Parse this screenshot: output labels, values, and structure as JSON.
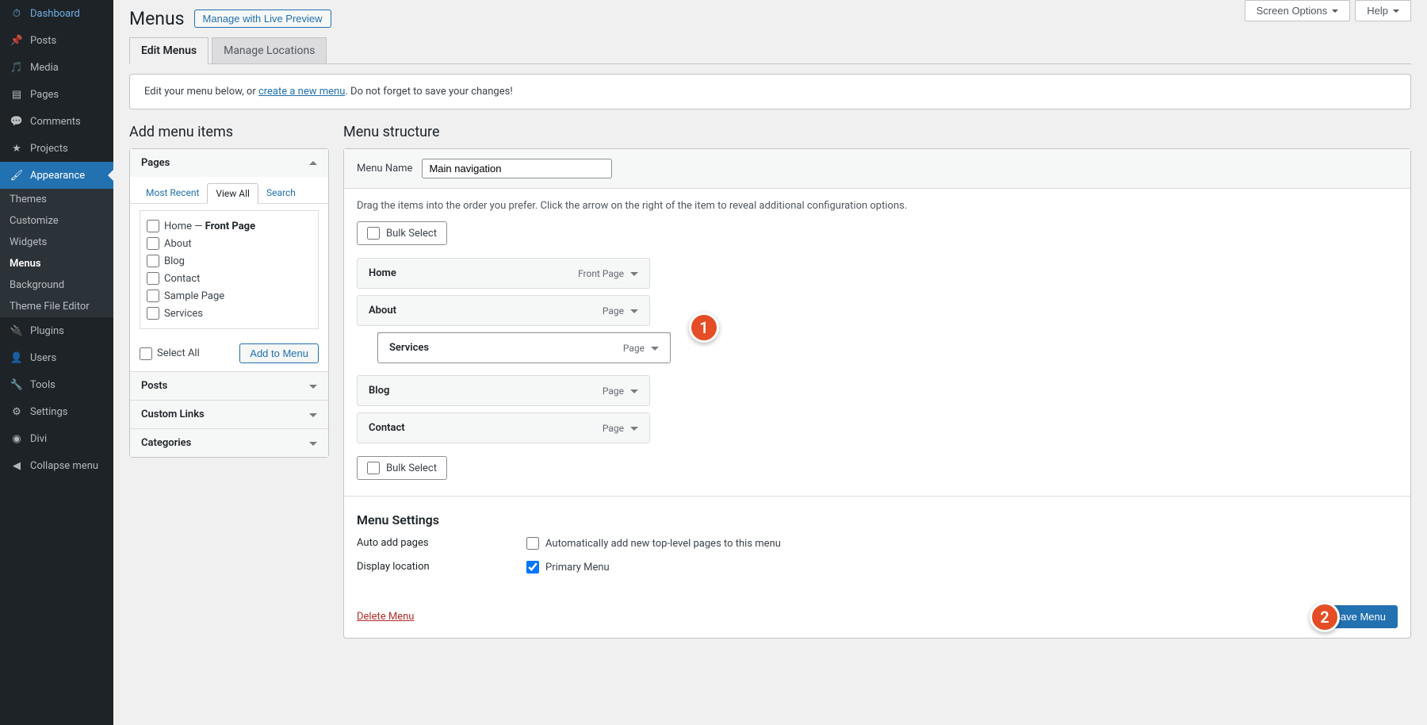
{
  "sidebar": {
    "items": [
      {
        "label": "Dashboard",
        "icon": "dashboard-icon"
      },
      {
        "label": "Posts",
        "icon": "pin-icon"
      },
      {
        "label": "Media",
        "icon": "media-icon"
      },
      {
        "label": "Pages",
        "icon": "pages-icon"
      },
      {
        "label": "Comments",
        "icon": "comments-icon"
      },
      {
        "label": "Projects",
        "icon": "projects-icon"
      },
      {
        "label": "Appearance",
        "icon": "brush-icon"
      },
      {
        "label": "Plugins",
        "icon": "plugin-icon"
      },
      {
        "label": "Users",
        "icon": "users-icon"
      },
      {
        "label": "Tools",
        "icon": "tools-icon"
      },
      {
        "label": "Settings",
        "icon": "settings-icon"
      },
      {
        "label": "Divi",
        "icon": "divi-icon"
      },
      {
        "label": "Collapse menu",
        "icon": "collapse-icon"
      }
    ],
    "subitems": [
      "Themes",
      "Customize",
      "Widgets",
      "Menus",
      "Background",
      "Theme File Editor"
    ]
  },
  "top_right": {
    "screen_options": "Screen Options",
    "help": "Help"
  },
  "header": {
    "title": "Menus",
    "preview_btn": "Manage with Live Preview"
  },
  "tabs": {
    "edit": "Edit Menus",
    "manage": "Manage Locations"
  },
  "info": {
    "prefix": "Edit your menu below, or ",
    "link": "create a new menu",
    "suffix": ". Do not forget to save your changes!"
  },
  "left": {
    "title": "Add menu items",
    "accordion": {
      "pages": "Pages",
      "posts": "Posts",
      "custom_links": "Custom Links",
      "categories": "Categories"
    },
    "inner_tabs": {
      "recent": "Most Recent",
      "all": "View All",
      "search": "Search"
    },
    "page_options": [
      {
        "label": "Home — ",
        "suffix": "Front Page"
      },
      {
        "label": "About"
      },
      {
        "label": "Blog"
      },
      {
        "label": "Contact"
      },
      {
        "label": "Sample Page"
      },
      {
        "label": "Services"
      }
    ],
    "select_all": "Select All",
    "add_btn": "Add to Menu"
  },
  "right": {
    "title": "Menu structure",
    "menu_name_label": "Menu Name",
    "menu_name_value": "Main navigation",
    "hint": "Drag the items into the order you prefer. Click the arrow on the right of the item to reveal additional configuration options.",
    "bulk": "Bulk Select",
    "items": [
      {
        "label": "Home",
        "type": "Front Page"
      },
      {
        "label": "About",
        "type": "Page"
      },
      {
        "label": "Services",
        "type": "Page"
      },
      {
        "label": "Blog",
        "type": "Page"
      },
      {
        "label": "Contact",
        "type": "Page"
      }
    ],
    "settings_title": "Menu Settings",
    "auto_label": "Auto add pages",
    "auto_opt": "Automatically add new top-level pages to this menu",
    "display_label": "Display location",
    "display_opt": "Primary Menu",
    "delete": "Delete Menu",
    "save": "Save Menu"
  },
  "annotations": {
    "one": "1",
    "two": "2"
  }
}
